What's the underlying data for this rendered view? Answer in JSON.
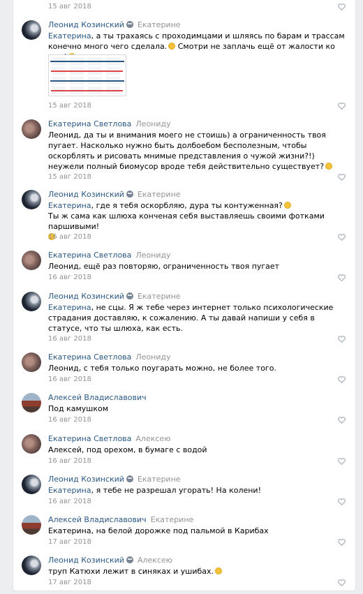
{
  "comments": [
    {
      "author": "",
      "alien": false,
      "reply_to": "",
      "mention": "",
      "text": "",
      "date": "15 авг 2018",
      "avatar": ""
    },
    {
      "author": "Леонид Козинский",
      "alien": true,
      "reply_to": "Екатерине",
      "mention": "Екатерина",
      "text": ", а ты трахаясь с проходимцами и шляясь по барам и трассам конечно много чего сделала.",
      "text2": " Смотри не заплачь ещё от жалости ко мне!",
      "date": "15 авг 2018",
      "avatar": "dark"
    },
    {
      "author": "Екатерина Светлова",
      "alien": false,
      "reply_to": "Леониду",
      "mention": "",
      "text": "Леонид, да ты и внимания моего не стоишь) а ограниченность твоя пугает. Насколько нужно быть долбоебом бесполезным, чтобы оскорблять и рисовать мнимые представления о чужой жизни?!) неужели полный биомусор вроде тебя действительно существует?",
      "date": "15 авг 2018",
      "avatar": "girl"
    },
    {
      "author": "Леонид Козинский",
      "alien": true,
      "reply_to": "Екатерине",
      "mention": "Екатерина",
      "text": ", где я тебя оскорбляю, дура ты контуженная?",
      "text2": "Ты ж сама как шлюха конченая себя выставляешь своими фотками паршивыми!",
      "date": "16 авг 2018",
      "avatar": "dark"
    },
    {
      "author": "Екатерина Светлова",
      "alien": false,
      "reply_to": "Леониду",
      "mention": "",
      "text": "Леонид, ещё раз повторяю, ограниченность твоя пугает",
      "date": "16 авг 2018",
      "avatar": "girl"
    },
    {
      "author": "Леонид Козинский",
      "alien": true,
      "reply_to": "Екатерине",
      "mention": "Екатерина",
      "text": ", не сцы. Я ж тебе через интернет только психологические страдания доставляю, к сожалению. А ты давай напиши у себя в статусе, что ты шлюха, как есть.",
      "date": "16 авг 2018",
      "avatar": "dark"
    },
    {
      "author": "Екатерина Светлова",
      "alien": false,
      "reply_to": "Леониду",
      "mention": "",
      "text": "Леонид, с тебя только поугарать можно, не более того.",
      "date": "16 авг 2018",
      "avatar": "girl"
    },
    {
      "author": "Алексей Владиславович",
      "alien": false,
      "reply_to": "",
      "mention": "",
      "text": "Под камушком",
      "date": "16 авг 2018",
      "avatar": "city"
    },
    {
      "author": "Екатерина Светлова",
      "alien": false,
      "reply_to": "Алексею",
      "mention": "",
      "text": "Алексей, под орехом, в бумаге с водой",
      "date": "16 авг 2018",
      "avatar": "girl"
    },
    {
      "author": "Леонид Козинский",
      "alien": true,
      "reply_to": "Екатерине",
      "mention": "Екатерина",
      "text": ", я тебе не разрешал угорать! На колени!",
      "date": "16 авг 2018",
      "avatar": "dark"
    },
    {
      "author": "Алексей Владиславович",
      "alien": false,
      "reply_to": "Екатерине",
      "mention": "",
      "text": "Екатерина, на белой дорожке под пальмой в Карибах",
      "date": "17 авг 2018",
      "avatar": "city"
    },
    {
      "author": "Леонид Козинский",
      "alien": true,
      "reply_to": "Алексею",
      "mention": "",
      "text": "труп Катюхи лежит в синяках и ушибах.",
      "date": "17 авг 2018",
      "avatar": "dark"
    }
  ],
  "colors": {
    "link": "#2a5885",
    "meta": "#939393",
    "background": "#edeef0"
  },
  "icons": {
    "like": "heart-icon",
    "alien": "alien-emoji-icon",
    "smile": "smile-emoji-icon"
  }
}
